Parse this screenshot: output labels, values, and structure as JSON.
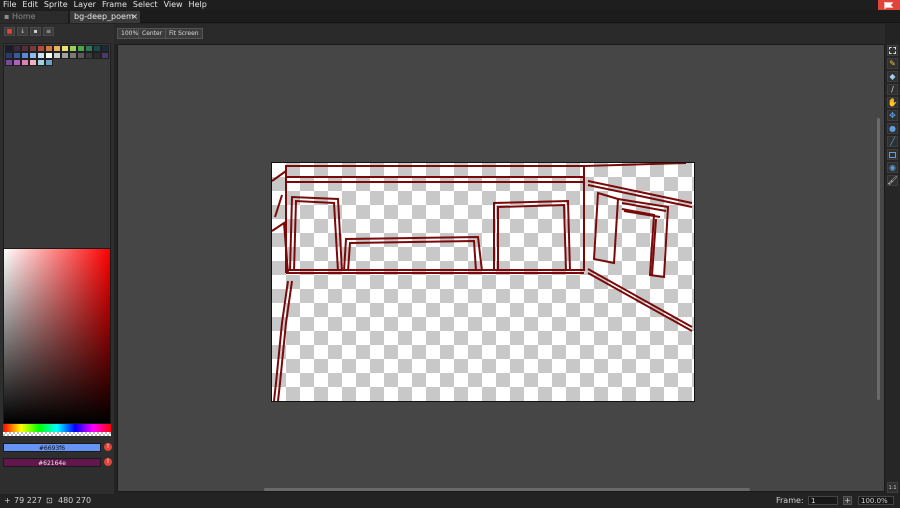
{
  "menubar": {
    "items": [
      {
        "label": "File",
        "key": "F"
      },
      {
        "label": "Edit",
        "key": "E"
      },
      {
        "label": "Sprite",
        "key": "S"
      },
      {
        "label": "Layer",
        "key": "L"
      },
      {
        "label": "Frame",
        "key": "F"
      },
      {
        "label": "Select",
        "key": "S"
      },
      {
        "label": "View",
        "key": "V"
      },
      {
        "label": "Help",
        "key": "H"
      }
    ],
    "logo_icon": "app-logo-flag-icon"
  },
  "tabs": {
    "home_label": "Home",
    "home_icon": "folder-icon",
    "active_label": "bg-deep_poem",
    "close_glyph": "×"
  },
  "layer_buttons": [
    "lock-icon",
    "arrow-down-icon",
    "document-icon",
    "menu-icon"
  ],
  "palette": {
    "colors": [
      "#1a1a2e",
      "#3b2a3e",
      "#5a2a3a",
      "#7a3a3a",
      "#b84a3a",
      "#d47a3a",
      "#e6b45a",
      "#f0e07a",
      "#9ad05a",
      "#4aa84a",
      "#2a7a5a",
      "#1a4a4a",
      "#1a2a3a",
      "#2a3a6a",
      "#3a5aa0",
      "#5a8ad0",
      "#8ab8f0",
      "#c8e0f8",
      "#ffffff",
      "#d0d0d0",
      "#a0a0a0",
      "#7a7a7a",
      "#5a5a5a",
      "#3a3a3a",
      "#2a2a2a",
      "#4a3a6a",
      "#7a4a9a",
      "#b060c0",
      "#e080b0",
      "#f0b0c0",
      "#a0d0e0",
      "#6aa0c0"
    ]
  },
  "colors": {
    "primary_hex": "#6693f6",
    "secondary_hex": "#62164e",
    "accent": "#e0443a"
  },
  "canvas_toolbar": {
    "zoom_100": "100%",
    "center": "Center",
    "fit_screen": "Fit Screen"
  },
  "tools": [
    "marquee-icon",
    "pencil-icon",
    "eraser-icon",
    "eyedropper-icon",
    "hand-icon",
    "move-icon",
    "fill-bucket-icon",
    "line-icon",
    "rectangle-icon",
    "lasso-icon",
    "brush-icon"
  ],
  "tool_fit_label": "1:1",
  "statusbar": {
    "cursor_coords": "79 227",
    "sprite_size": "480 270",
    "frame_label": "Frame:",
    "frame_value": "1",
    "zoom_value": "100.0%"
  }
}
